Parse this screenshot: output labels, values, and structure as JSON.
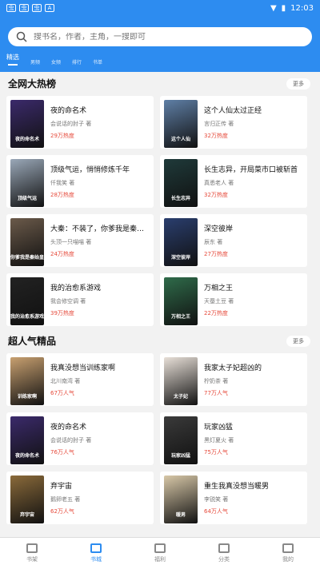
{
  "status": {
    "time": "12:03"
  },
  "search": {
    "placeholder": "搜书名，作者，主角，一搜即可"
  },
  "tabs": [
    "精选",
    "男频",
    "女频",
    "排行",
    "书单"
  ],
  "sections": [
    {
      "title": "全网大热榜",
      "more": "更多",
      "books": [
        {
          "title": "夜的命名术",
          "author": "会说话的肘子 著",
          "stat": "29万热度",
          "cover_text": "夜的命名术",
          "color": "#3b2a6b"
        },
        {
          "title": "这个人仙太过正经",
          "author": "言归正传 著",
          "stat": "32万热度",
          "cover_text": "这个人仙",
          "color": "#5f7fa6"
        },
        {
          "title": "顶级气运，悄悄修炼千年",
          "author": "仟我笑 著",
          "stat": "28万热度",
          "cover_text": "顶级气运",
          "color": "#9aa8b8"
        },
        {
          "title": "长生志异，开局菜市口被斩首",
          "author": "真悉老人 著",
          "stat": "32万热度",
          "cover_text": "长生志异",
          "color": "#1f3a3a"
        },
        {
          "title": "大秦：不装了，你爹我是秦始皇",
          "author": "头顶一只喵喵 著",
          "stat": "24万热度",
          "cover_text": "你爹我是秦始皇",
          "color": "#6b5a4a"
        },
        {
          "title": "深空彼岸",
          "author": "辰东 著",
          "stat": "27万热度",
          "cover_text": "深空彼岸",
          "color": "#2a3e6e"
        },
        {
          "title": "我的治愈系游戏",
          "author": "我会修空调 著",
          "stat": "39万热度",
          "cover_text": "我的治愈系游戏",
          "color": "#222222"
        },
        {
          "title": "万相之王",
          "author": "天蚕土豆 著",
          "stat": "22万热度",
          "cover_text": "万相之王",
          "color": "#2f6b4a"
        }
      ]
    },
    {
      "title": "超人气精品",
      "more": "更多",
      "books": [
        {
          "title": "我真没想当训练家啊",
          "author": "北川南湾 著",
          "stat": "67万人气",
          "cover_text": "训练家啊",
          "color": "#c8a070"
        },
        {
          "title": "我家太子妃超凶的",
          "author": "柠奶茶 著",
          "stat": "77万人气",
          "cover_text": "太子妃",
          "color": "#e8e0d8"
        },
        {
          "title": "夜的命名术",
          "author": "会说话的肘子 著",
          "stat": "76万人气",
          "cover_text": "夜的命名术",
          "color": "#3b2a6b"
        },
        {
          "title": "玩家凶猛",
          "author": "黑灯夏火 著",
          "stat": "75万人气",
          "cover_text": "玩家凶猛",
          "color": "#3a3a3a"
        },
        {
          "title": "弃宇宙",
          "author": "鹅卵老五 著",
          "stat": "62万人气",
          "cover_text": "弃宇宙",
          "color": "#8a6a3a"
        },
        {
          "title": "重生我真没想当暖男",
          "author": "李锐笑 著",
          "stat": "64万人气",
          "cover_text": "暖男",
          "color": "#d8c8a8"
        }
      ]
    }
  ],
  "bottom_nav": [
    {
      "label": "书架",
      "active": false
    },
    {
      "label": "书城",
      "active": true
    },
    {
      "label": "福利",
      "active": false
    },
    {
      "label": "分类",
      "active": false
    },
    {
      "label": "我的",
      "active": false
    }
  ]
}
